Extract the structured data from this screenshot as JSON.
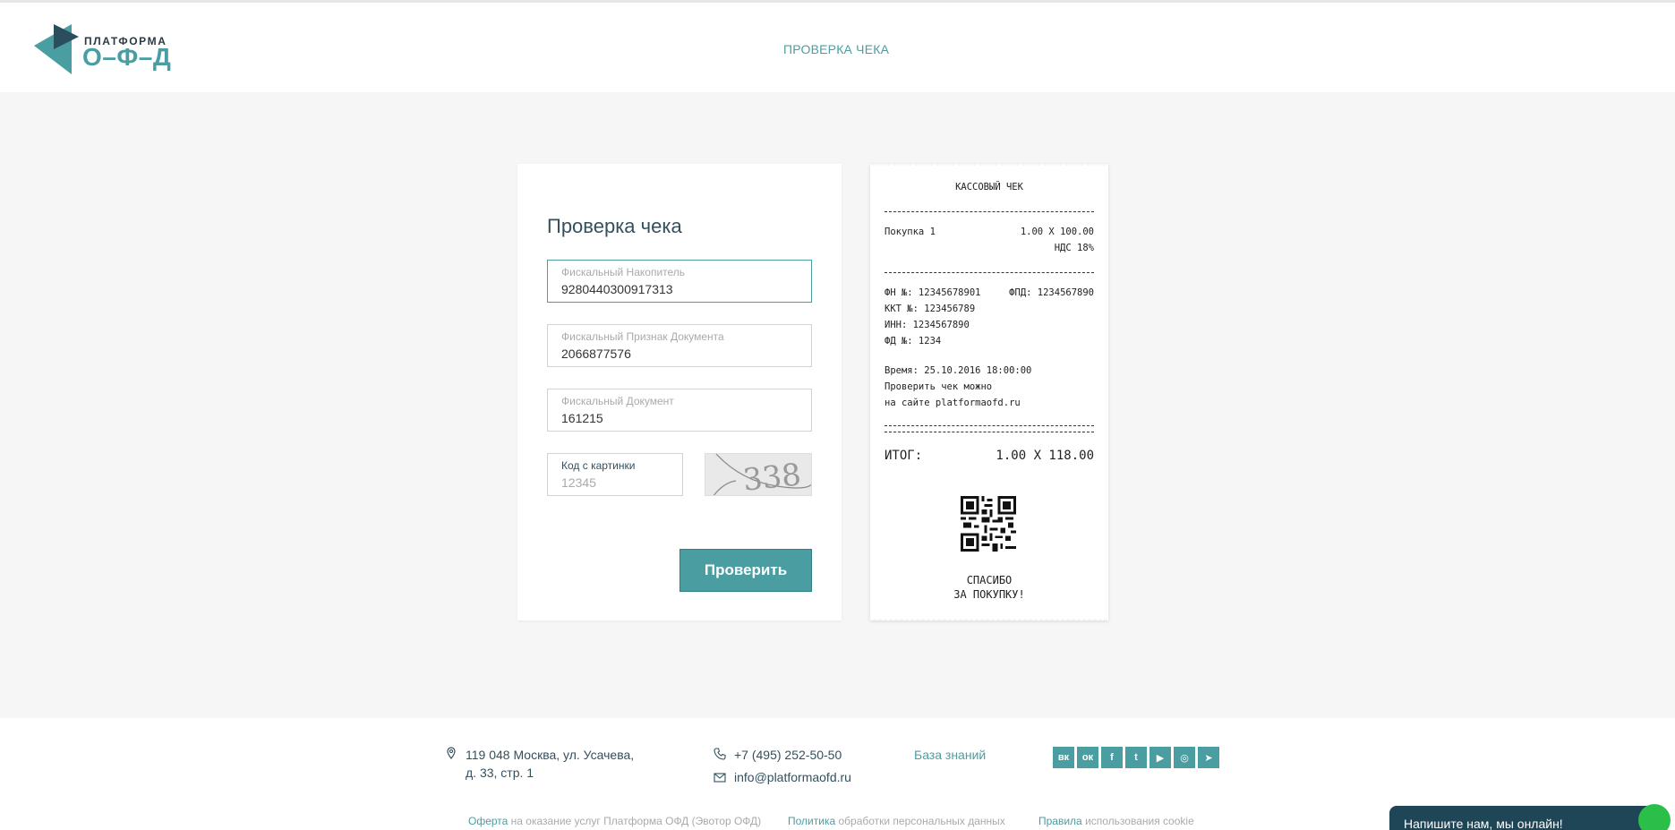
{
  "header": {
    "logo_top": "ПЛАТФОРМА",
    "logo_bottom": "О–Ф–Д",
    "nav_check": "ПРОВЕРКА ЧЕКА"
  },
  "form": {
    "title": "Проверка чека",
    "fn_label": "Фискальный Накопитель",
    "fn_value": "9280440300917313",
    "fpd_label": "Фискальный Признак Документа",
    "fpd_value": "2066877576",
    "fd_label": "Фискальный Документ",
    "fd_value": "161215",
    "captcha_label": "Код с картинки",
    "captcha_placeholder": "12345",
    "captcha_digits": "338",
    "submit_label": "Проверить"
  },
  "receipt": {
    "title": "КАССОВЫЙ ЧЕК",
    "item_name": "Покупка 1",
    "item_price": "1.00 X 100.00",
    "item_vat": "НДС 18%",
    "fn_line": "ФН №: 12345678901",
    "fpd_line": "ФПД: 1234567890",
    "kkt_line": "ККТ №: 123456789",
    "inn_line": "ИНН: 1234567890",
    "fd_line": "ФД №: 1234",
    "time_line": "Время: 25.10.2016 18:00:00",
    "check_line1": "Проверить чек можно",
    "check_line2": "на сайте platformaofd.ru",
    "total_label": "ИТОГ:",
    "total_value": "1.00 X 118.00",
    "thanks1": "СПАСИБО",
    "thanks2": "ЗА ПОКУПКУ!"
  },
  "footer": {
    "address1": "119 048 Москва, ул. Усачева,",
    "address2": "д. 33, стр. 1",
    "phone": "+7 (495) 252-50-50",
    "email": "info@platformaofd.ru",
    "knowledge_base": "База знаний",
    "socials": [
      "вк",
      "ок",
      "f",
      "t",
      "▶",
      "◎",
      "➤"
    ],
    "offer_link": "Оферта",
    "offer_text": " на оказание услуг Платформа ОФД (Эвотор ОФД)",
    "policy_link": "Политика",
    "policy_text": " обработки персональных данных",
    "rules_link": "Правила",
    "rules_text": " использования cookie"
  },
  "chat": {
    "label": "Напишите нам, мы онлайн!"
  },
  "colors": {
    "accent": "#4a9ea2",
    "dark": "#33505e",
    "chat_bg": "#1f4656",
    "online": "#2bbf4a"
  }
}
